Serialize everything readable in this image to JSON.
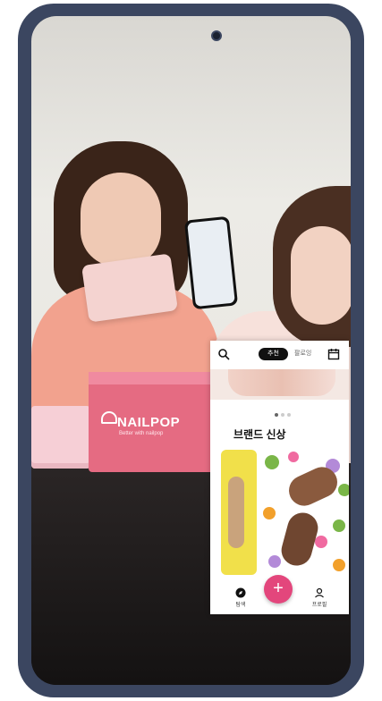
{
  "video": {
    "brand_box_label": "NAILPOP",
    "brand_box_sub": "Better with nailpop"
  },
  "app": {
    "tabs": {
      "active_label": "추천",
      "other_label": "팔로잉"
    },
    "section_title": "브랜드 신상",
    "bottom_nav": {
      "left_label": "탐색",
      "right_label": "프로필",
      "add_label": "+"
    },
    "colors": {
      "accent": "#e3467c",
      "phone_frame": "#3b4660"
    }
  }
}
